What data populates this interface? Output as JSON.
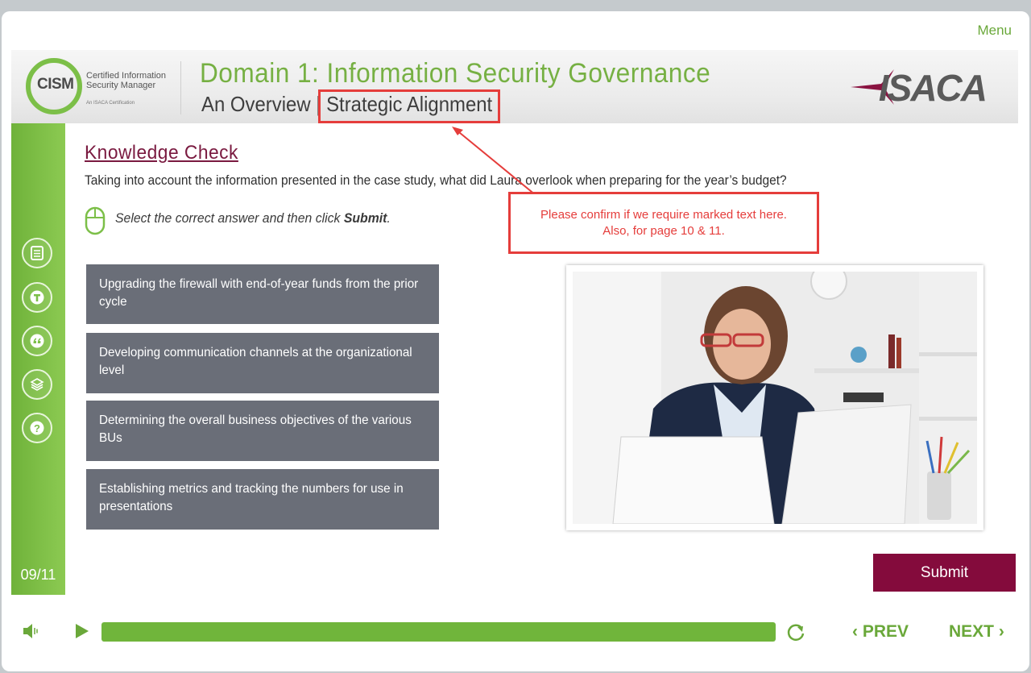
{
  "header": {
    "menu_label": "Menu",
    "logo": {
      "acronym": "CISM",
      "subtitle": "Certified Information Security Manager",
      "tagline": "An ISACA Certification"
    },
    "domain_title": "Domain 1: Information Security Governance",
    "subtitle_prefix": "An Overview | ",
    "subtitle_topic": "Strategic Alignment",
    "brand": "ISACA"
  },
  "sidebar": {
    "icons": [
      "notes-icon",
      "text-icon",
      "quote-icon",
      "layers-icon",
      "help-icon"
    ],
    "page_counter": "09/11"
  },
  "content": {
    "heading": "Knowledge Check",
    "question": "Taking into account the information presented in the case study, what did Laura overlook when preparing for the year’s budget?",
    "instruction_prefix": "Select the correct answer and then click ",
    "instruction_action": "Submit",
    "instruction_suffix": ".",
    "options": [
      "Upgrading the firewall with end-of-year funds from the prior cycle",
      "Developing communication channels at the organizational level",
      "Determining the overall business objectives of the various BUs",
      "Establishing metrics and tracking the numbers for use in presentations"
    ],
    "submit_label": "Submit"
  },
  "review_note": {
    "line1": "Please confirm if we require marked text here.",
    "line2": "Also, for page 10 & 11."
  },
  "footer": {
    "progress_fraction": 1.0,
    "prev_label": "PREV",
    "next_label": "NEXT"
  },
  "colors": {
    "accent_green": "#76b043",
    "maroon": "#840b3c",
    "option_gray": "#6a6e78",
    "annotation_red": "#e53d3b"
  }
}
